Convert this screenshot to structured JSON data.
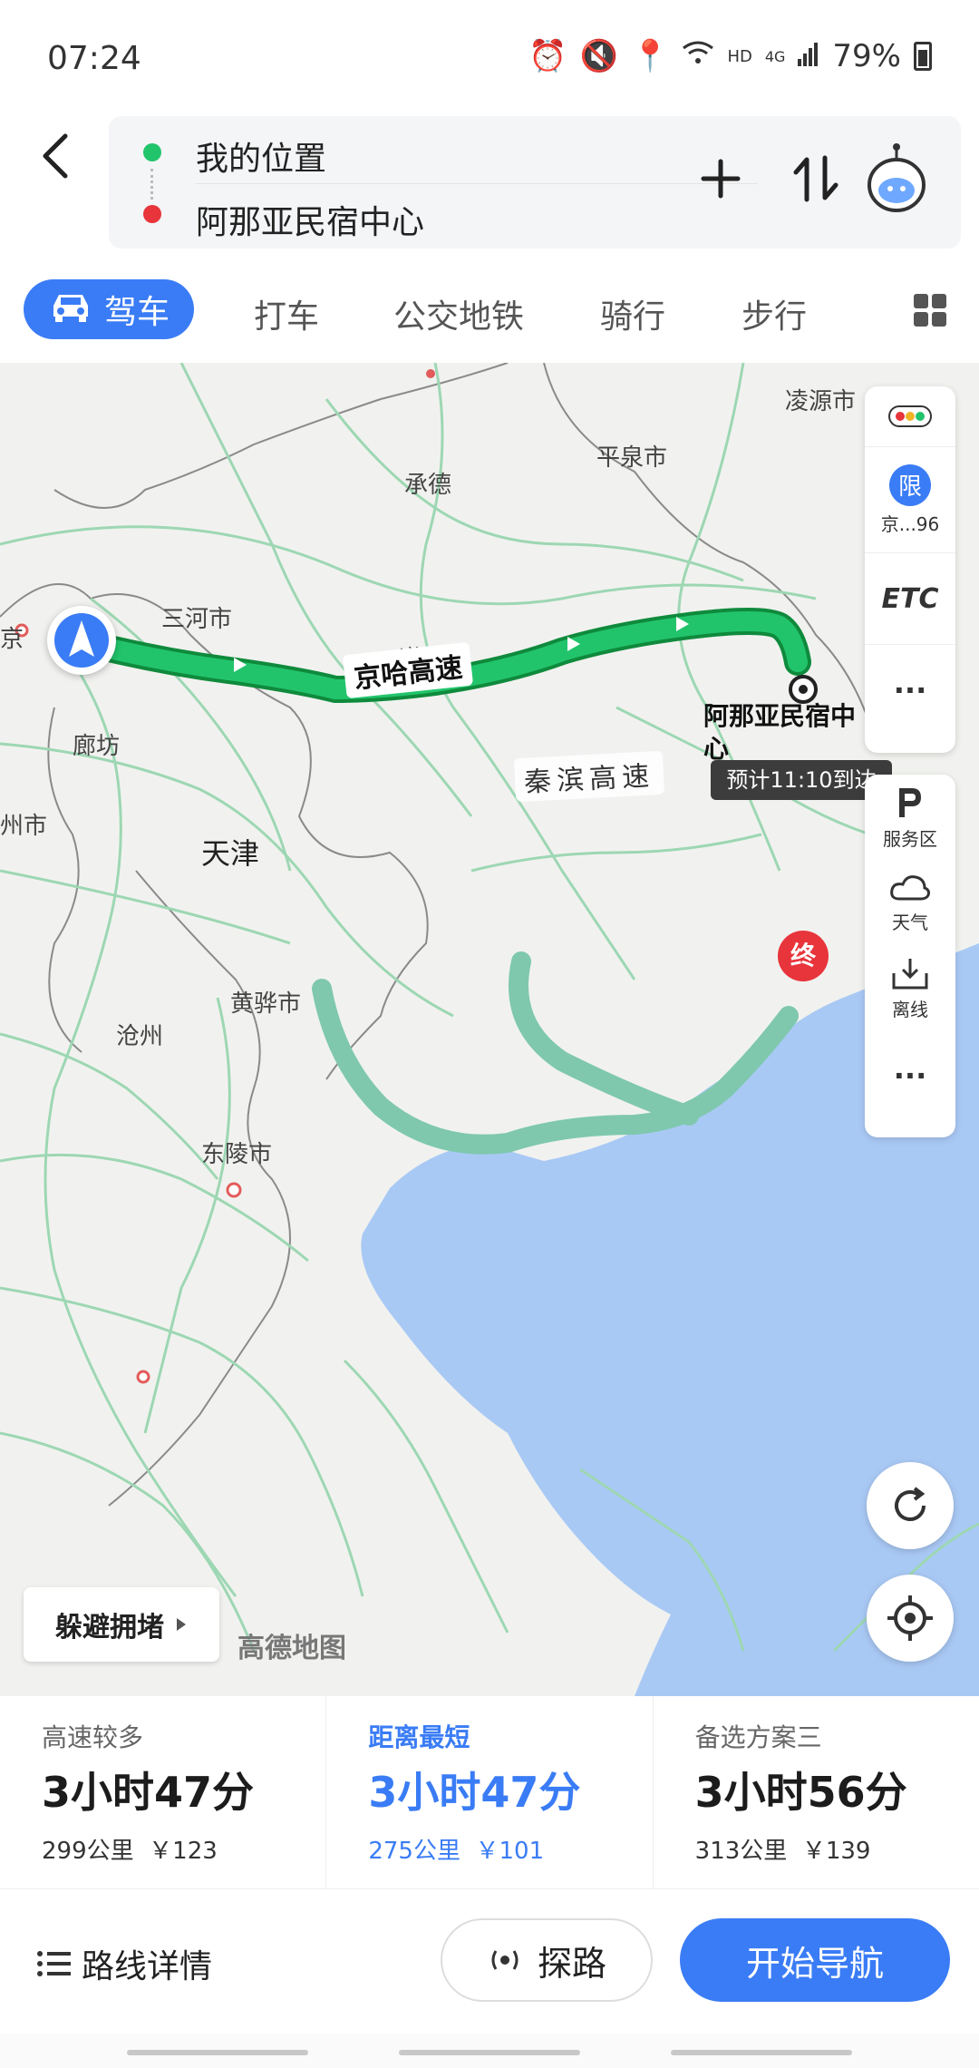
{
  "status_bar": {
    "time": "07:24",
    "network": "HD",
    "network_type": "4G",
    "battery": "79%"
  },
  "route": {
    "from": "我的位置",
    "to": "阿那亚民宿中心"
  },
  "modes": {
    "active": "驾车",
    "items": [
      "打车",
      "公交地铁",
      "骑行",
      "步行"
    ]
  },
  "map": {
    "cities": {
      "lingyuan": "凌源市",
      "pingquan": "平泉市",
      "chengde": "承德",
      "zunhua": "遵化市",
      "sanhe": "三河市",
      "langfang": "廊坊",
      "tianjin": "天津",
      "huanghua": "黄骅市",
      "cangzhou": "沧州",
      "bazhou": "州市",
      "jing": "京",
      "dongling": "东陵市"
    },
    "roads": {
      "main": "京哈高速",
      "alt": "秦滨高速"
    },
    "end_marker": "终",
    "destination_label": "阿那亚民宿中心",
    "eta": "预计11:10到达",
    "side_panel": {
      "limit_badge": "限",
      "limit_text": "京...96",
      "etc": "ETC",
      "service_area": "服务区",
      "weather": "天气",
      "offline": "离线"
    },
    "avoid_button": "躲避拥堵",
    "watermark": "高德地图"
  },
  "options": [
    {
      "title": "高速较多",
      "duration": "3小时47分",
      "distance": "299公里",
      "cost": "￥123"
    },
    {
      "title": "距离最短",
      "duration": "3小时47分",
      "distance": "275公里",
      "cost": "￥101"
    },
    {
      "title": "备选方案三",
      "duration": "3小时56分",
      "distance": "313公里",
      "cost": "￥139"
    }
  ],
  "actions": {
    "details": "路线详情",
    "probe": "探路",
    "start": "开始导航"
  },
  "colors": {
    "accent": "#3a7cf5",
    "route_main": "#1fb85a",
    "route_alt": "#7fc8ae",
    "water": "#a9c9f5",
    "end": "#e8343b"
  }
}
